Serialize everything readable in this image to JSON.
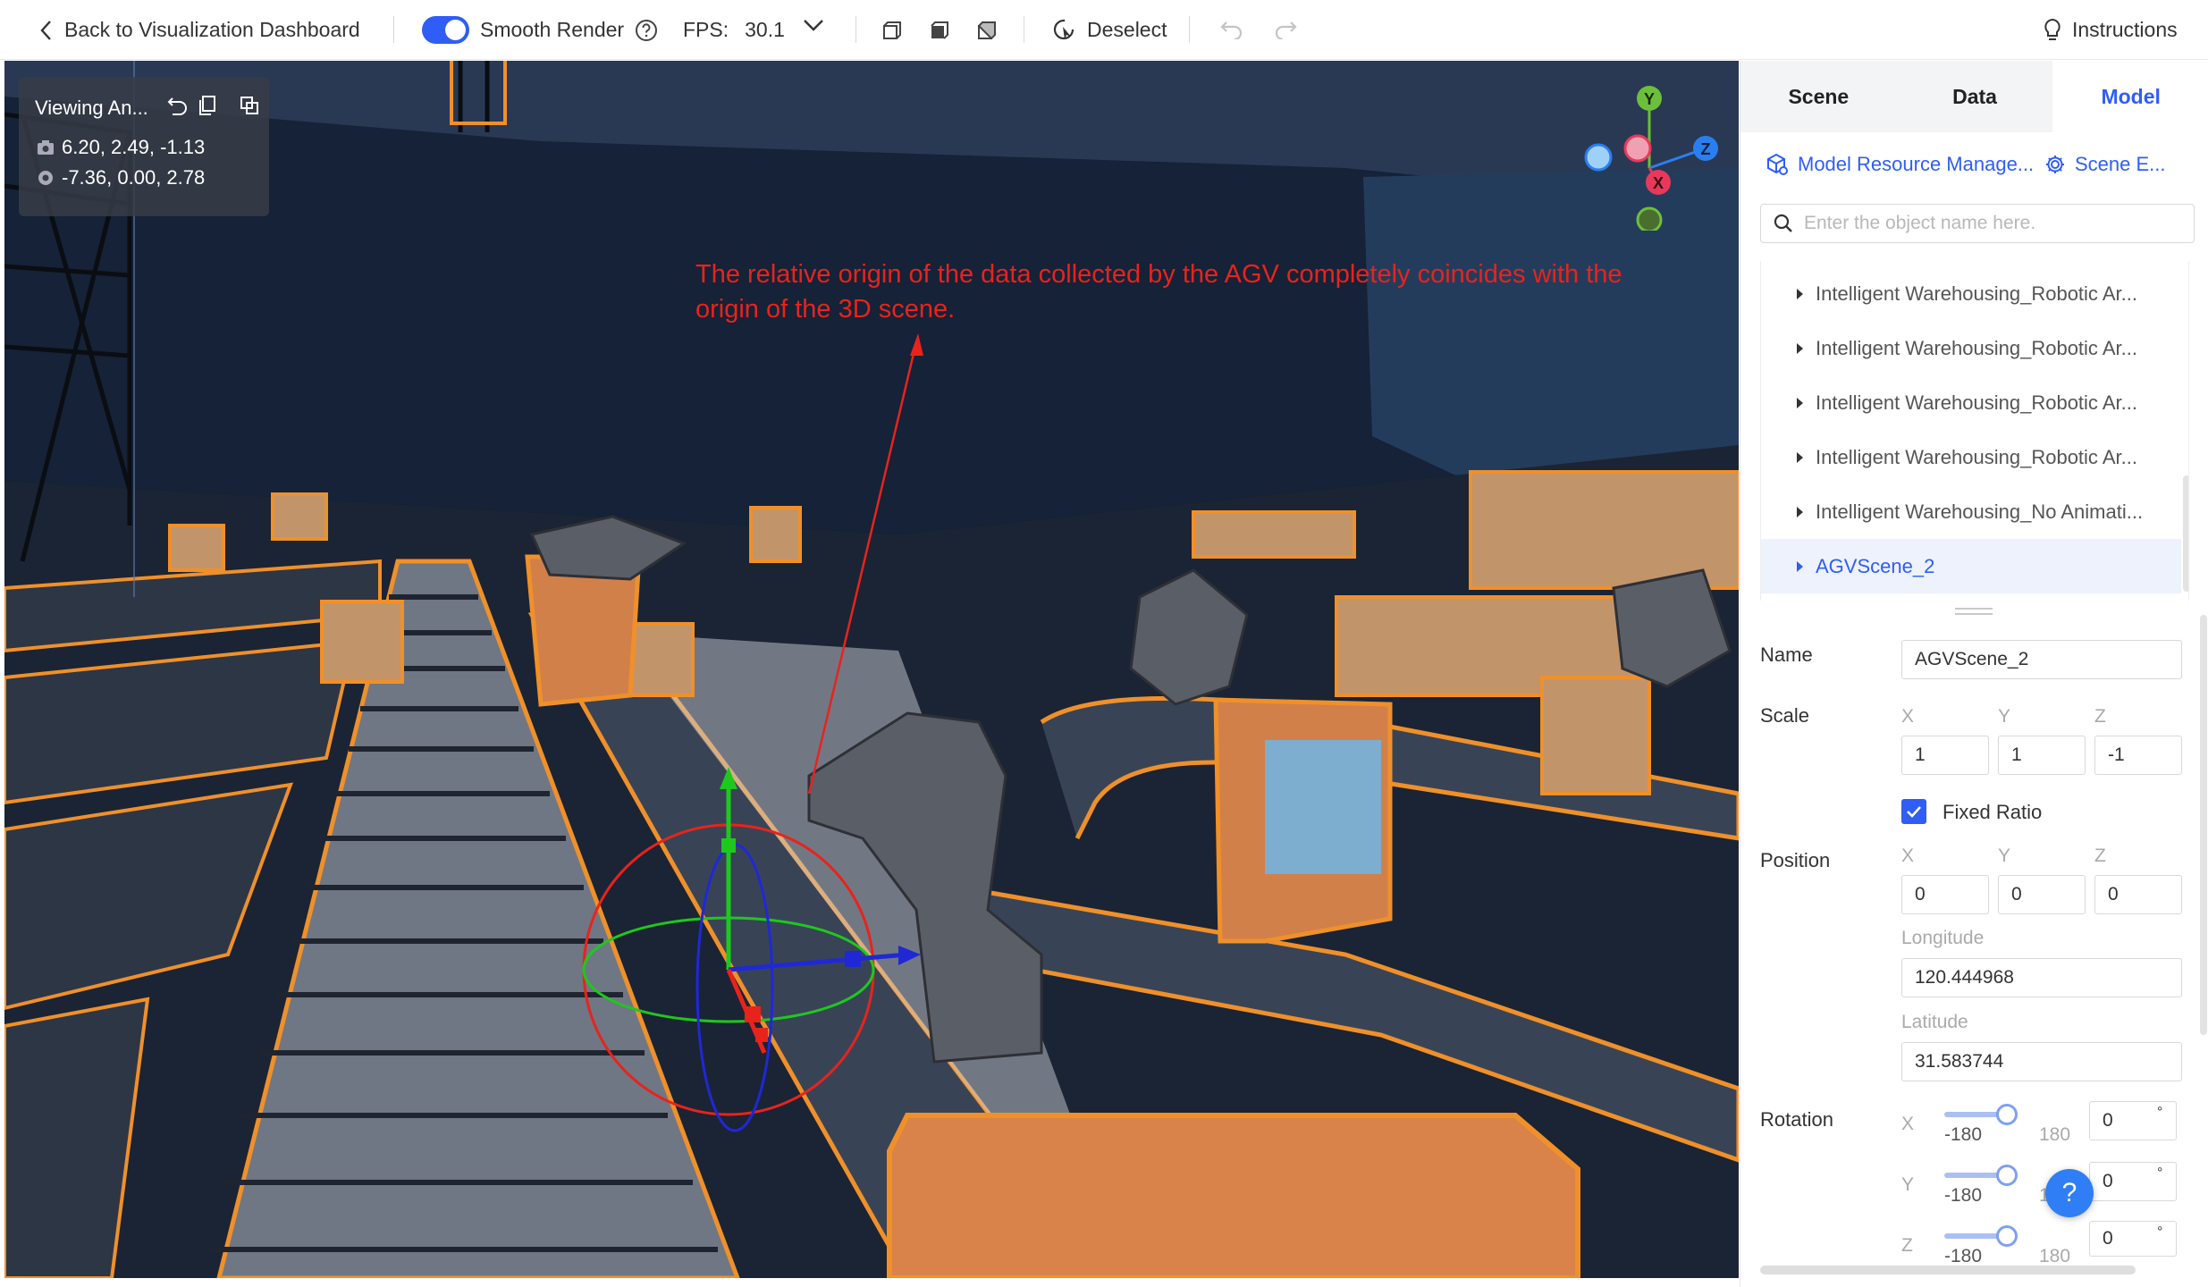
{
  "toolbar": {
    "back_label": "Back to Visualization Dashboard",
    "smooth_render_label": "Smooth Render",
    "fps_label": "FPS:",
    "fps_value": "30.1",
    "deselect_label": "Deselect",
    "instructions_label": "Instructions",
    "smooth_render_on": true
  },
  "camera_panel": {
    "title": "Viewing An...",
    "camera_position": "6.20, 2.49, -1.13",
    "target_position": "-7.36, 0.00, 2.78"
  },
  "annotation": {
    "text": "The relative origin of the data collected by the AGV completely coincides with the origin of the 3D scene.",
    "color": "#e8231c"
  },
  "axis_gizmo": {
    "y": "Y",
    "x": "X",
    "z": "Z"
  },
  "panel": {
    "tabs": [
      {
        "label": "Scene",
        "active": false
      },
      {
        "label": "Data",
        "active": false
      },
      {
        "label": "Model",
        "active": true
      }
    ],
    "resource_link": "Model Resource Manage...",
    "scene_link": "Scene E...",
    "search_placeholder": "Enter the object name here.",
    "tree": [
      {
        "label": "Intelligent Warehousing_Robotic Ar...",
        "selected": false
      },
      {
        "label": "Intelligent Warehousing_Robotic Ar...",
        "selected": false
      },
      {
        "label": "Intelligent Warehousing_Robotic Ar...",
        "selected": false
      },
      {
        "label": "Intelligent Warehousing_Robotic Ar...",
        "selected": false
      },
      {
        "label": "Intelligent Warehousing_No Animati...",
        "selected": false
      },
      {
        "label": "AGVScene_2",
        "selected": true
      }
    ],
    "props": {
      "name_label": "Name",
      "name_value": "AGVScene_2",
      "scale_label": "Scale",
      "axis_x": "X",
      "axis_y": "Y",
      "axis_z": "Z",
      "scale": {
        "x": "1",
        "y": "1",
        "z": "-1"
      },
      "fixed_ratio_label": "Fixed Ratio",
      "fixed_ratio_checked": true,
      "position_label": "Position",
      "position": {
        "x": "0",
        "y": "0",
        "z": "0"
      },
      "longitude_label": "Longitude",
      "longitude_value": "120.444968",
      "latitude_label": "Latitude",
      "latitude_value": "31.583744",
      "rotation_label": "Rotation",
      "rotation_min": "-180",
      "rotation_max": "180",
      "rotation": {
        "x": "0",
        "y": "0",
        "z": "0"
      },
      "degree_symbol": "°"
    },
    "help_label": "?"
  },
  "colors": {
    "accent": "#2f5df6",
    "scene_outline": "#f0902a",
    "floor": "#1a2434"
  }
}
